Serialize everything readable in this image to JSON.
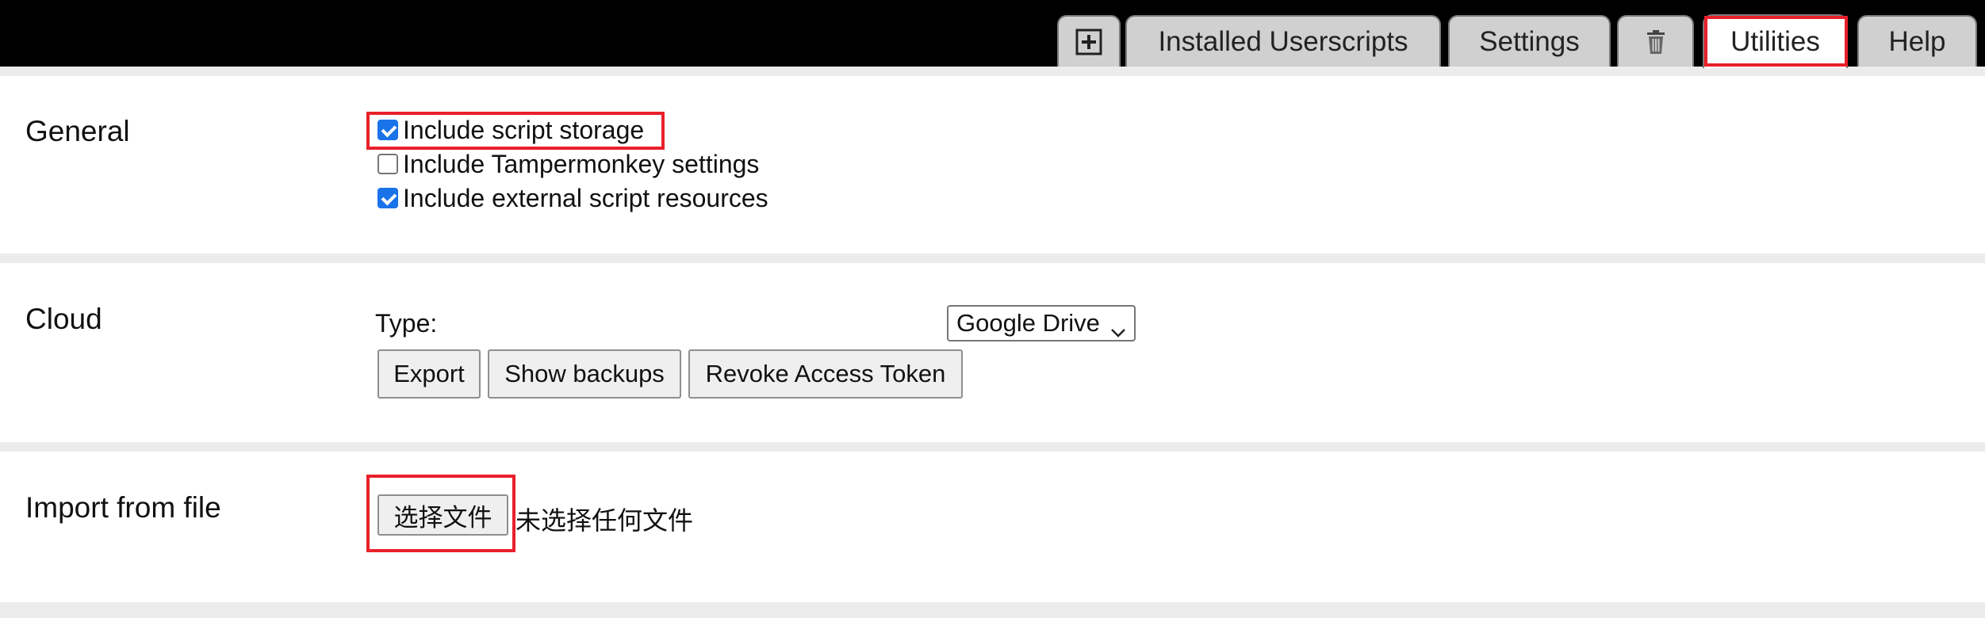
{
  "tabs": {
    "add_label": "",
    "installed": "Installed Userscripts",
    "settings": "Settings",
    "utilities": "Utilities",
    "help": "Help"
  },
  "general": {
    "title": "General",
    "options": [
      {
        "label": "Include script storage",
        "checked": true
      },
      {
        "label": "Include Tampermonkey settings",
        "checked": false
      },
      {
        "label": "Include external script resources",
        "checked": true
      }
    ]
  },
  "cloud": {
    "title": "Cloud",
    "type_label": "Type:",
    "type_value": "Google Drive",
    "export_label": "Export",
    "show_backups_label": "Show backups",
    "revoke_label": "Revoke Access Token"
  },
  "import": {
    "title": "Import from file",
    "choose_label": "选择文件",
    "no_file_text": "未选择任何文件"
  },
  "colors": {
    "highlight": "#e8202a",
    "checkbox": "#1a73e8",
    "topbar": "#000000"
  }
}
